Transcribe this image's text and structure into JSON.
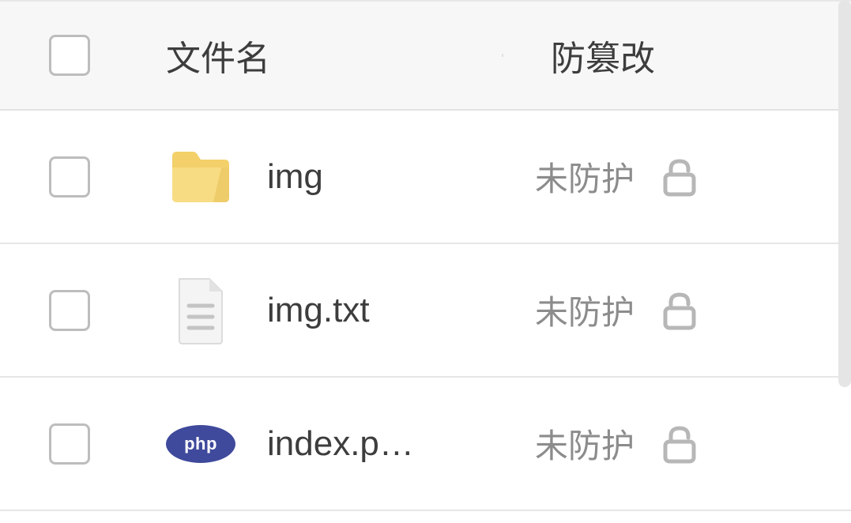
{
  "header": {
    "name_label": "文件名",
    "status_label": "防篡改"
  },
  "rows": [
    {
      "icon": "folder",
      "name": "img",
      "status": "未防护"
    },
    {
      "icon": "textfile",
      "name": "img.txt",
      "status": "未防护"
    },
    {
      "icon": "php",
      "name": "index.p…",
      "status": "未防护"
    }
  ],
  "php_badge_text": "php"
}
